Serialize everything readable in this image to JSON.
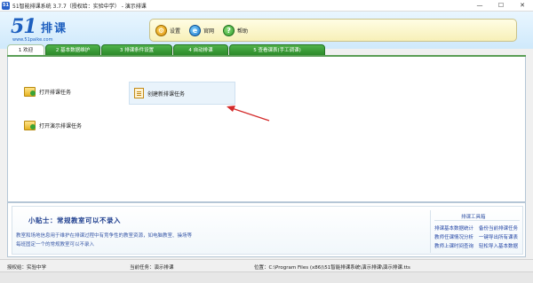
{
  "window": {
    "title": "51智能排课系统 3.7.7（授权给：实验中学） - 演示排课",
    "app_icon": "app-icon",
    "controls": [
      "—",
      "☐",
      "✕"
    ]
  },
  "header": {
    "logo_number": "51",
    "logo_text": "排课",
    "logo_url": "www.51paike.com",
    "toolbar": [
      {
        "label": "设置",
        "icon": "gear-icon"
      },
      {
        "label": "官网",
        "icon": "globe-icon"
      },
      {
        "label": "帮助",
        "icon": "help-icon"
      }
    ]
  },
  "tabs": [
    {
      "label": "1 欢迎",
      "active": true
    },
    {
      "label": "2 基本数据维护",
      "active": false
    },
    {
      "label": "3 排课条件设置",
      "active": false
    },
    {
      "label": "4 自动排课",
      "active": false
    },
    {
      "label": "5 查看课表(手工调课)",
      "active": false
    }
  ],
  "main": {
    "open_task": "打开排课任务",
    "new_task": "创建新排课任务",
    "open_demo": "打开演示排课任务"
  },
  "tips": {
    "title": "小贴士：常规教室可以不录入",
    "line1": "教室和场地信息用于维护在排课过程中有竞争性的教室资源，如电脑教室、操场等",
    "line2": "每班固定一个的常规教室可以不录入"
  },
  "tools": {
    "title": "排课工具箱",
    "links": [
      "排课基本数据统计",
      "备份当前排课任务",
      "教师任课情况分析",
      "一键导出所有课表",
      "教师上课时间查询",
      "轻松导入基本数据"
    ]
  },
  "status": {
    "licensee": "授权给：实验中学",
    "current_task": "当前任务：演示排课",
    "location": "位置：C:\\Program Files (x86)\\51智能排课系统\\演示排课\\演示排课.tts"
  },
  "colors": {
    "accent_blue": "#1d5fbf",
    "tab_green": "#2c8a2a",
    "toolbar_yellow": "#f7f0b8",
    "arrow_red": "#d42a2a"
  }
}
